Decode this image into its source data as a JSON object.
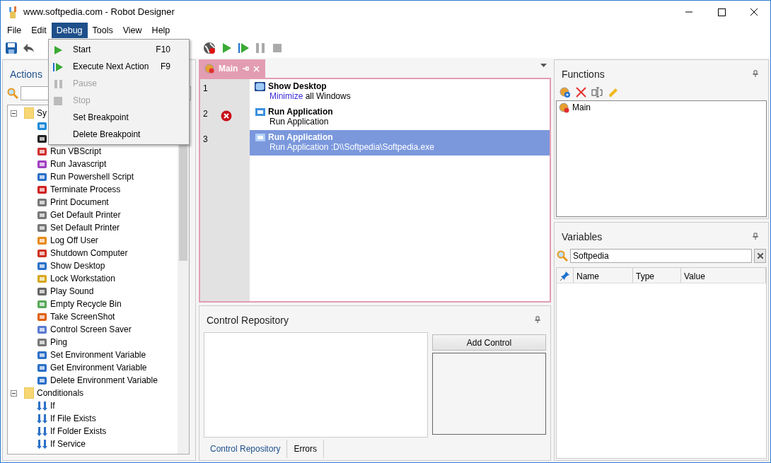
{
  "window": {
    "title": "www.softpedia.com - Robot Designer"
  },
  "menu": [
    {
      "label": "File",
      "selected": false
    },
    {
      "label": "Edit",
      "selected": false
    },
    {
      "label": "Debug",
      "selected": true
    },
    {
      "label": "Tools",
      "selected": false
    },
    {
      "label": "View",
      "selected": false
    },
    {
      "label": "Help",
      "selected": false
    }
  ],
  "debug_menu": [
    {
      "label": "Start",
      "shortcut": "F10",
      "disabled": false,
      "kind": "play"
    },
    {
      "label": "Execute Next Action",
      "shortcut": "F9",
      "disabled": false,
      "kind": "step"
    },
    {
      "label": "Pause",
      "disabled": true,
      "kind": "pause"
    },
    {
      "label": "Stop",
      "disabled": true,
      "kind": "stop"
    },
    {
      "label": "Set Breakpoint",
      "disabled": false,
      "kind": "none"
    },
    {
      "label": "Delete Breakpoint",
      "disabled": false,
      "kind": "none"
    }
  ],
  "actions": {
    "title": "Actions",
    "tree": [
      {
        "label": "Sy",
        "expanded": true,
        "children": [
          {
            "kind": "icon_only"
          },
          {
            "kind": "icon_only"
          },
          {
            "label": "Run VBScript"
          },
          {
            "label": "Run Javascript"
          },
          {
            "label": "Run Powershell Script"
          },
          {
            "label": "Terminate Process"
          },
          {
            "label": "Print Document"
          },
          {
            "label": "Get Default Printer"
          },
          {
            "label": "Set Default Printer"
          },
          {
            "label": "Log Off User"
          },
          {
            "label": "Shutdown Computer"
          },
          {
            "label": "Show Desktop"
          },
          {
            "label": "Lock Workstation"
          },
          {
            "label": "Play Sound"
          },
          {
            "label": "Empty Recycle Bin"
          },
          {
            "label": "Take ScreenShot"
          },
          {
            "label": "Control Screen Saver"
          },
          {
            "label": "Ping"
          },
          {
            "label": "Set Environment Variable"
          },
          {
            "label": "Get Environment Variable"
          },
          {
            "label": "Delete Environment Variable"
          }
        ]
      },
      {
        "label": "Conditionals",
        "expanded": true,
        "children": [
          {
            "label": "If"
          },
          {
            "label": "If File Exists"
          },
          {
            "label": "If Folder Exists"
          },
          {
            "label": "If Service"
          }
        ]
      }
    ]
  },
  "editor": {
    "tab": {
      "label": "Main"
    },
    "rows": [
      {
        "line": "1",
        "breakpoint": false,
        "selected": false,
        "title": "Show Desktop",
        "keyword": "Minimize",
        "text": "all Windows"
      },
      {
        "line": "2",
        "breakpoint": true,
        "selected": false,
        "title": "Run Application",
        "text": "Run Application"
      },
      {
        "line": "3",
        "breakpoint": false,
        "selected": true,
        "title": "Run Application",
        "text": "Run Application :D\\\\Softpedia\\Softpedia.exe"
      }
    ]
  },
  "control_repository": {
    "title": "Control Repository",
    "button": "Add Control",
    "tabs": [
      {
        "label": "Control Repository",
        "selected": true
      },
      {
        "label": "Errors",
        "selected": false
      }
    ]
  },
  "functions": {
    "title": "Functions",
    "items": [
      "Main"
    ]
  },
  "variables": {
    "title": "Variables",
    "search": "Softpedia",
    "columns": [
      "Name",
      "Type",
      "Value"
    ]
  }
}
